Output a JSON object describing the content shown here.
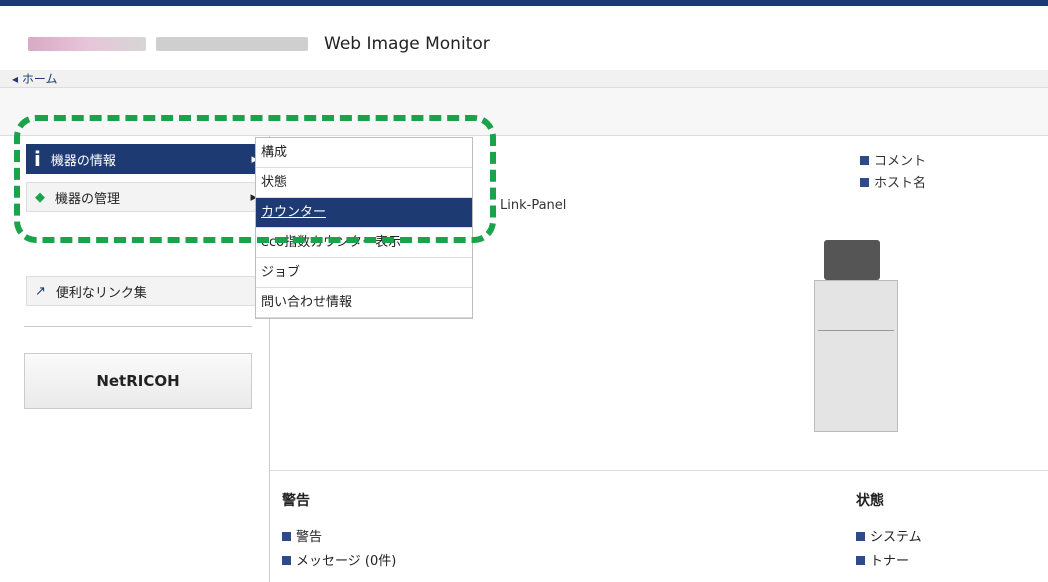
{
  "header": {
    "product": "Web Image Monitor"
  },
  "breadcrumb": {
    "home": "ホーム"
  },
  "menu": {
    "items": [
      {
        "label": "機器の情報"
      },
      {
        "label": "機器の管理"
      },
      {
        "label": "便利なリンク集"
      }
    ],
    "netricoh": "NetRICOH"
  },
  "submenu": {
    "items": [
      "構成",
      "状態",
      "カウンター",
      "eco指数カウンター表示",
      "ジョブ",
      "問い合わせ情報"
    ]
  },
  "device": {
    "model_suffix": "Link-Panel"
  },
  "info": {
    "comment": "コメント",
    "host": "ホスト名"
  },
  "alerts": {
    "heading": "警告",
    "items": [
      "警告",
      "メッセージ (0件)"
    ]
  },
  "status": {
    "heading": "状態",
    "items": [
      "システム",
      "トナー"
    ]
  }
}
